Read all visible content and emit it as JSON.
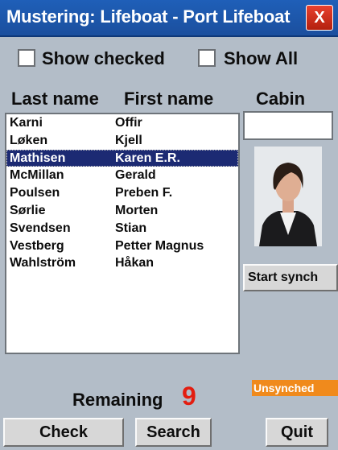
{
  "window": {
    "title": "Mustering: Lifeboat - Port Lifeboat",
    "close_label": "X"
  },
  "filters": {
    "show_checked_label": "Show checked",
    "show_all_label": "Show All"
  },
  "columns": {
    "last_name": "Last name",
    "first_name": "First name",
    "cabin": "Cabin"
  },
  "people": [
    {
      "last": "Karni",
      "first": "Offir"
    },
    {
      "last": "Løken",
      "first": "Kjell"
    },
    {
      "last": "Mathisen",
      "first": "Karen E.R."
    },
    {
      "last": "McMillan",
      "first": "Gerald"
    },
    {
      "last": "Poulsen",
      "first": "Preben F."
    },
    {
      "last": "Sørlie",
      "first": "Morten"
    },
    {
      "last": "Svendsen",
      "first": "Stian"
    },
    {
      "last": "Vestberg",
      "first": "Petter Magnus"
    },
    {
      "last": "Wahlström",
      "first": "Håkan"
    }
  ],
  "selected_index": 2,
  "cabin_value": "",
  "sync": {
    "button_label": "Start synch",
    "status": "Unsynched"
  },
  "remaining": {
    "label": "Remaining",
    "count": "9"
  },
  "buttons": {
    "check": "Check",
    "search": "Search",
    "quit": "Quit"
  }
}
